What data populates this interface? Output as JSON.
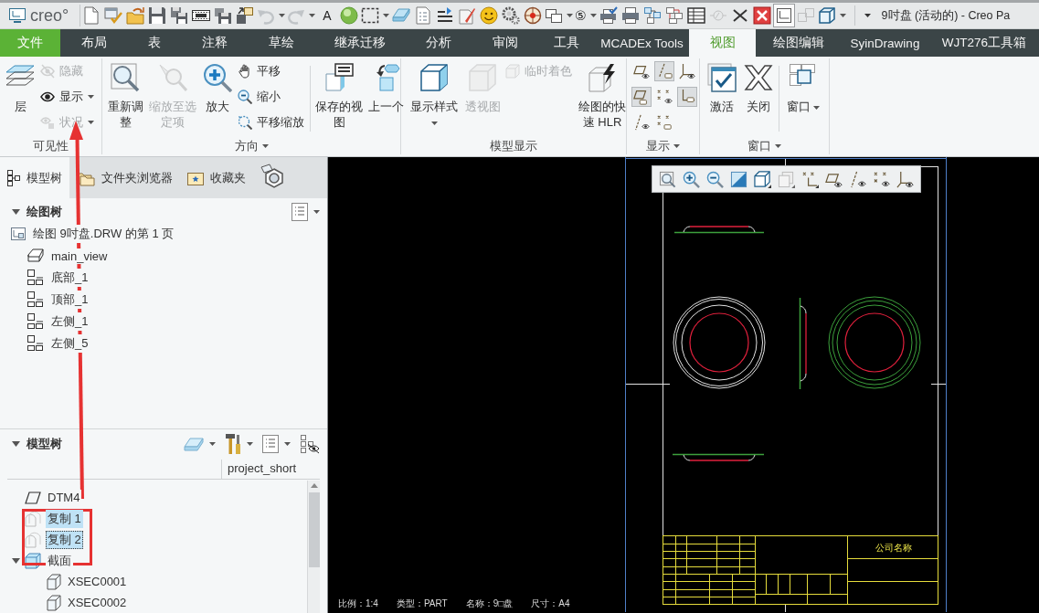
{
  "title_bar": {
    "logo": "creo°",
    "quick_access": [
      {
        "disabled": false,
        "dropdown": false,
        "toggled": false
      },
      {
        "disabled": false,
        "dropdown": false,
        "toggled": false
      },
      {
        "disabled": false,
        "dropdown": false,
        "toggled": false
      },
      {
        "disabled": false,
        "dropdown": false,
        "toggled": false
      },
      {
        "disabled": false,
        "dropdown": false,
        "toggled": false
      },
      {
        "disabled": false,
        "dropdown": false,
        "toggled": false
      },
      {
        "disabled": false,
        "dropdown": false,
        "toggled": false
      },
      {
        "disabled": false,
        "dropdown": false,
        "toggled": false
      },
      {
        "disabled": true,
        "dropdown": true,
        "toggled": false
      },
      {
        "disabled": true,
        "dropdown": true,
        "toggled": false
      },
      {
        "label": "A",
        "disabled": false,
        "dropdown": false,
        "toggled": false
      },
      {
        "disabled": false,
        "dropdown": false,
        "toggled": false
      },
      {
        "disabled": false,
        "dropdown": true,
        "toggled": false
      },
      {
        "disabled": false,
        "dropdown": false,
        "toggled": false
      },
      {
        "disabled": false,
        "dropdown": false,
        "toggled": false
      },
      {
        "disabled": false,
        "dropdown": false,
        "toggled": false
      },
      {
        "disabled": false,
        "dropdown": false,
        "toggled": false
      },
      {
        "disabled": false,
        "dropdown": false,
        "toggled": false
      },
      {
        "disabled": false,
        "dropdown": false,
        "toggled": false
      },
      {
        "disabled": false,
        "dropdown": false,
        "toggled": false
      },
      {
        "disabled": false,
        "dropdown": true,
        "toggled": false
      },
      {
        "label": "⑤",
        "disabled": false,
        "dropdown": true,
        "toggled": false
      },
      {
        "disabled": false,
        "dropdown": false,
        "toggled": false
      },
      {
        "disabled": false,
        "dropdown": false,
        "toggled": false
      },
      {
        "disabled": false,
        "dropdown": false,
        "toggled": false
      },
      {
        "disabled": false,
        "dropdown": false,
        "toggled": false
      },
      {
        "disabled": false,
        "dropdown": false,
        "toggled": false
      },
      {
        "disabled": true,
        "dropdown": false,
        "toggled": false
      },
      {
        "disabled": false,
        "dropdown": false,
        "toggled": false
      },
      {
        "disabled": false,
        "dropdown": false,
        "toggled": false
      },
      {
        "disabled": false,
        "dropdown": false,
        "toggled": true
      },
      {
        "disabled": true,
        "dropdown": false,
        "toggled": false
      },
      {
        "disabled": false,
        "dropdown": true,
        "toggled": false
      }
    ],
    "title": "9吋盘 (活动的) - Creo Pa"
  },
  "ribbon_tabs": [
    {
      "label": "文件",
      "kind": "file",
      "selected": false
    },
    {
      "label": "布局",
      "kind": "tab",
      "selected": false
    },
    {
      "label": "表",
      "kind": "tab",
      "selected": false
    },
    {
      "label": "注释",
      "kind": "tab",
      "selected": false
    },
    {
      "label": "草绘",
      "kind": "tab",
      "selected": false
    },
    {
      "label": "继承迁移",
      "kind": "tab",
      "selected": false
    },
    {
      "label": "分析",
      "kind": "tab",
      "selected": false
    },
    {
      "label": "审阅",
      "kind": "tab",
      "selected": false
    },
    {
      "label": "工具",
      "kind": "tab",
      "selected": false
    },
    {
      "label": "MCADEx Tools",
      "kind": "tab",
      "selected": false
    },
    {
      "label": "视图",
      "kind": "tab",
      "selected": true
    },
    {
      "label": "绘图编辑",
      "kind": "tab",
      "selected": false
    },
    {
      "label": "SyinDrawing",
      "kind": "tab",
      "selected": false
    },
    {
      "label": "WJT276工具箱",
      "kind": "tab",
      "selected": false
    }
  ],
  "ribbon": {
    "groups": [
      {
        "label": "可见性",
        "dropdown": false,
        "controls": [
          {
            "kind": "large",
            "label": "层",
            "disabled": false,
            "dropdown": false
          },
          {
            "kind": "stack",
            "items": [
              {
                "label": "隐藏",
                "disabled": true,
                "dropdown": false
              },
              {
                "label": "显示",
                "disabled": false,
                "dropdown": true
              },
              {
                "label": "状况",
                "disabled": true,
                "dropdown": true
              }
            ]
          }
        ]
      },
      {
        "label": "方向",
        "dropdown": true,
        "controls": [
          {
            "kind": "large",
            "label": "重新调整",
            "disabled": false,
            "dropdown": false
          },
          {
            "kind": "large",
            "label": "缩放至选定项",
            "disabled": true,
            "dropdown": false
          },
          {
            "kind": "large",
            "label": "放大",
            "disabled": false,
            "dropdown": false
          },
          {
            "kind": "stack",
            "items": [
              {
                "label": "平移",
                "disabled": false,
                "dropdown": false
              },
              {
                "label": "缩小",
                "disabled": false,
                "dropdown": false
              },
              {
                "label": "平移缩放",
                "disabled": false,
                "dropdown": false
              }
            ]
          },
          {
            "kind": "separator"
          },
          {
            "kind": "large",
            "label": "保存的视图",
            "disabled": false,
            "dropdown": false
          },
          {
            "kind": "large",
            "label": "上一个",
            "disabled": false,
            "dropdown": false
          }
        ]
      },
      {
        "label": "模型显示",
        "dropdown": false,
        "controls": [
          {
            "kind": "large",
            "label": "显示样式",
            "disabled": false,
            "dropdown": true
          },
          {
            "kind": "large",
            "label": "透视图",
            "disabled": true,
            "dropdown": false
          },
          {
            "kind": "stack",
            "items": [
              {
                "label": "临时着色",
                "disabled": true,
                "dropdown": false
              }
            ]
          },
          {
            "kind": "large",
            "label": "绘图的快速 HLR",
            "disabled": false,
            "dropdown": false
          }
        ]
      },
      {
        "label": "显示",
        "dropdown": true,
        "controls": [
          {
            "kind": "toggles",
            "items": [
              {
                "toggled": false
              },
              {
                "toggled": true
              },
              {
                "toggled": false
              },
              {
                "toggled": true
              },
              {
                "toggled": false
              },
              {
                "toggled": true
              },
              {
                "toggled": false
              },
              {
                "toggled": false
              }
            ]
          }
        ]
      },
      {
        "label": "窗口",
        "dropdown": true,
        "controls": [
          {
            "kind": "large",
            "label": "激活",
            "disabled": false,
            "dropdown": false
          },
          {
            "kind": "large",
            "label": "关闭",
            "disabled": false,
            "dropdown": false
          },
          {
            "kind": "separator"
          },
          {
            "kind": "large",
            "label": "窗口",
            "disabled": false,
            "dropdown": true
          }
        ]
      }
    ]
  },
  "side_panel": {
    "tabs": [
      {
        "label": "模型树",
        "selected": true
      },
      {
        "label": "文件夹浏览器",
        "selected": false
      },
      {
        "label": "收藏夹",
        "selected": false
      }
    ],
    "drawing_tree": {
      "title": "绘图树",
      "expanded": true,
      "items": [
        {
          "label": "绘图 9吋盘.DRW 的第 1 页",
          "kind": "sheet",
          "children": [
            {
              "label": "main_view",
              "kind": "general"
            },
            {
              "label": "底部_1",
              "kind": "projection"
            },
            {
              "label": "顶部_1",
              "kind": "projection"
            },
            {
              "label": "左侧_1",
              "kind": "projection"
            },
            {
              "label": "左侧_5",
              "kind": "projection"
            }
          ]
        }
      ]
    },
    "model_tree": {
      "title": "模型树",
      "expanded": true,
      "columns": [
        "project_short"
      ],
      "rows": [
        {
          "label": "DTM4",
          "kind": "plane",
          "selected": false,
          "focused": false
        },
        {
          "label": "复制 1",
          "kind": "copy",
          "selected": true,
          "focused": false
        },
        {
          "label": "复制 2",
          "kind": "copy",
          "selected": true,
          "focused": true
        },
        {
          "label": "截面",
          "kind": "folder",
          "selected": false,
          "focused": false,
          "expanded": true,
          "children": [
            {
              "label": "XSEC0001",
              "kind": "section",
              "selected": false,
              "focused": false
            },
            {
              "label": "XSEC0002",
              "kind": "section",
              "selected": false,
              "focused": false
            }
          ]
        }
      ]
    }
  },
  "canvas": {
    "company_name": "公司名称",
    "status": [
      "比例：1:4",
      "类型：PART",
      "名称：9□盘",
      "尺寸：A4"
    ]
  }
}
